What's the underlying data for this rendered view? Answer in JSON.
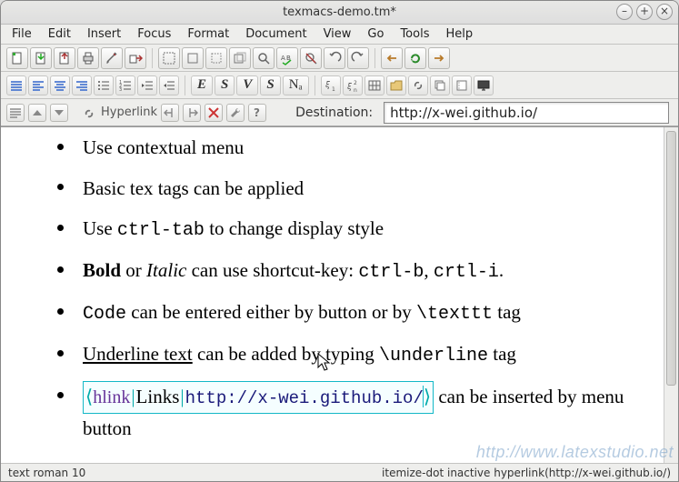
{
  "window": {
    "title": "texmacs-demo.tm*"
  },
  "menu": [
    "File",
    "Edit",
    "Insert",
    "Focus",
    "Format",
    "Document",
    "View",
    "Go",
    "Tools",
    "Help"
  ],
  "toolbar1_icons": [
    "new-doc",
    "open-doc",
    "save-doc",
    "print",
    "preferences",
    "export",
    "|",
    "page-box",
    "frame",
    "dashed-frame",
    "clip",
    "find",
    "spell",
    "bookmark",
    "undo",
    "redo",
    "|",
    "hand-left",
    "refresh",
    "hand-right"
  ],
  "toolbar2_icons_left": [
    "align-justify",
    "align-left",
    "align-center",
    "align-right",
    "list-bullets",
    "list-numbers",
    "indent",
    "outdent"
  ],
  "toolbar2_text_buttons": [
    "E",
    "S",
    "V",
    "S",
    "Nₐ"
  ],
  "toolbar2_icons_right": [
    "xi-sub",
    "xi-sup",
    "table",
    "folder",
    "link",
    "image-stack",
    "film",
    "present"
  ],
  "context": {
    "icons_left": [
      "paragraph",
      "triangle-up",
      "triangle-down"
    ],
    "hyperlink_label": "Hyperlink",
    "icons_mid": [
      "arrow-out",
      "arrow-in",
      "delete",
      "wrench",
      "help"
    ],
    "dest_label": "Destination:",
    "dest_value": "http://x-wei.github.io/"
  },
  "doc": {
    "b1": "Use contextual menu",
    "b2": "Basic tex tags can be applied",
    "b3_a": "Use ",
    "b3_code": "ctrl-tab",
    "b3_b": " to change display style",
    "b4_bold": "Bold",
    "b4_mid": " or ",
    "b4_italic": "Italic",
    "b4_b": " can use shortcut-key: ",
    "b4_c1": "ctrl-b",
    "b4_comma": ", ",
    "b4_c2": "crtl-i",
    "b4_dot": ".",
    "b5_code": "Code",
    "b5_mid": " can be entered either by button or by ",
    "b5_tag": "\\texttt",
    "b5_end": " tag",
    "b6_u": "Underline text",
    "b6_mid": " can be added by typing ",
    "b6_tag": "\\underline",
    "b6_end": " tag",
    "b7_hlink_tag": "hlink",
    "b7_link_text": "Links",
    "b7_url": "http://x-wei.github.io/",
    "b7_after": " can be inserted by menu button",
    "angle_l": "⟨",
    "angle_r": "⟩",
    "pipe": "|"
  },
  "status": {
    "left": "text roman 10",
    "right": "itemize-dot inactive hyperlink(http://x-wei.github.io/)"
  },
  "watermark": "http://www.latexstudio.net"
}
